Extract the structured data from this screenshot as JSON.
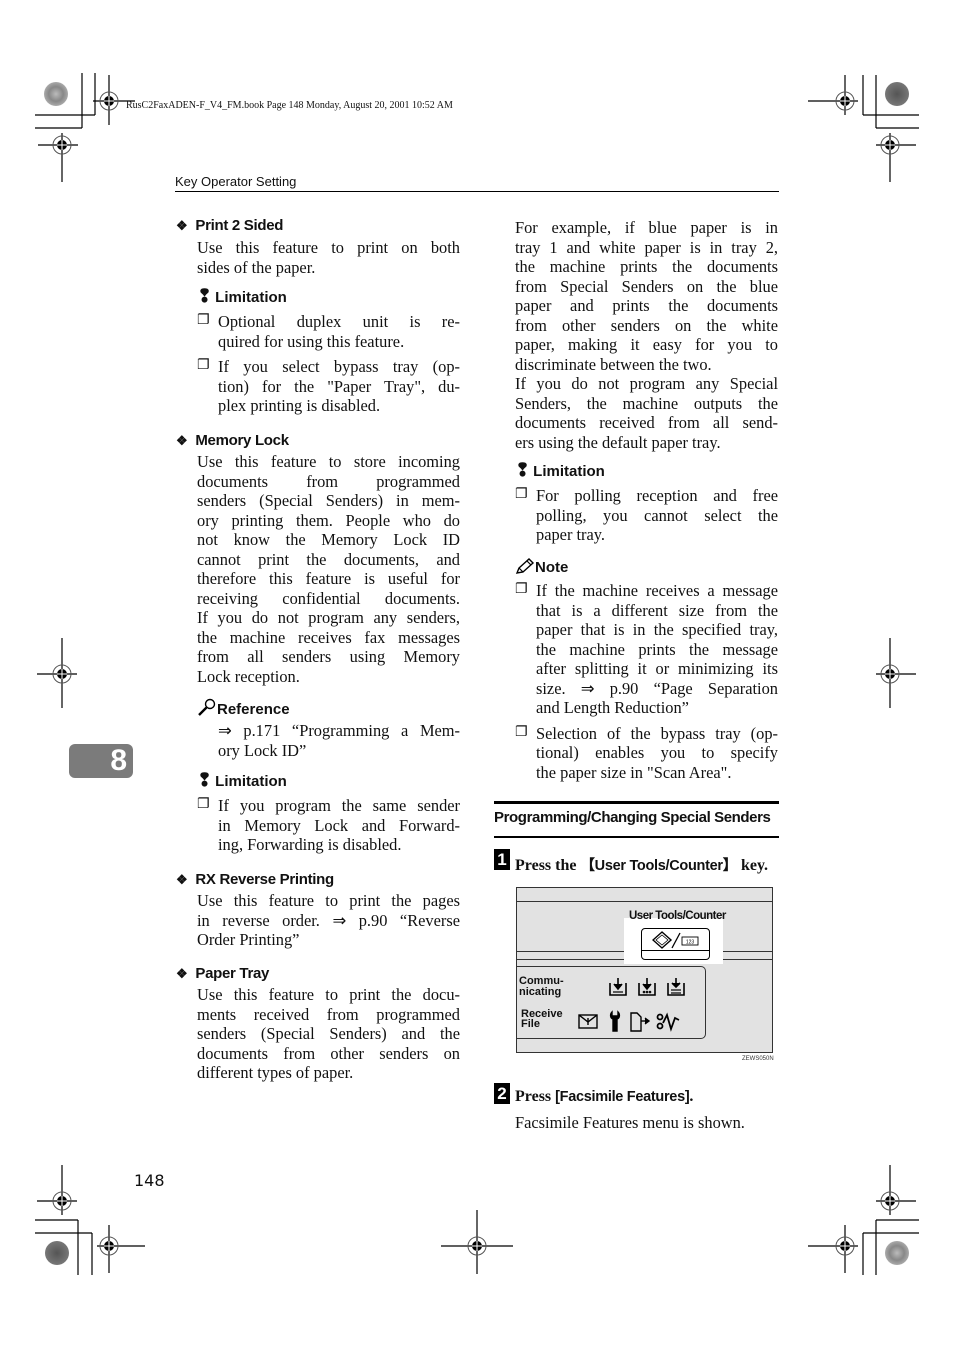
{
  "file_info": "RusC2FaxADEN-F_V4_FM.book  Page 148  Monday, August 20, 2001  10:52 AM",
  "running_head": "Key Operator Setting",
  "chapter_tab": "8",
  "page_number": "148",
  "left_column": {
    "print2sided": {
      "title": "Print 2 Sided",
      "body": [
        "Use this feature to print on both",
        "sides of the paper."
      ],
      "limitation_label": "Limitation",
      "items": [
        [
          "Optional duplex unit is re-",
          "quired for using this feature."
        ],
        [
          "If you select bypass tray (op-",
          "tion) for the \"Paper Tray\", du-",
          "plex printing is disabled."
        ]
      ]
    },
    "memory_lock": {
      "title": "Memory Lock",
      "body": [
        "Use this feature to store incoming",
        "documents from programmed",
        "senders (Special Senders) in mem-",
        "ory printing them. People who do",
        "not know the Memory Lock ID",
        "cannot print the documents, and",
        "therefore this feature is useful for",
        "receiving confidential documents.",
        "If you do not program any senders,",
        "the machine receives fax messages",
        "from all senders using Memory",
        "Lock reception."
      ],
      "reference_label": "Reference",
      "reference": [
        "⇒ p.171 “Programming a Mem-",
        "ory Lock ID”"
      ],
      "limitation_label": "Limitation",
      "items": [
        [
          "If you program the same sender",
          "in Memory Lock and Forward-",
          "ing, Forwarding is disabled."
        ]
      ]
    },
    "rx_reverse": {
      "title": "RX Reverse Printing",
      "body": [
        "Use this feature to print the pages",
        "in reverse order. ⇒ p.90 “Reverse",
        "Order Printing”"
      ]
    },
    "paper_tray": {
      "title": "Paper Tray",
      "body": [
        "Use this feature to print the docu-",
        "ments received from programmed",
        "senders (Special Senders) and the",
        "documents from other senders on",
        "different types of paper."
      ]
    }
  },
  "right_column": {
    "para1": [
      "For example, if blue paper is in",
      "tray 1 and white paper is in tray 2,",
      "the machine prints the documents",
      "from Special Senders on the blue",
      "paper and prints the documents",
      "from other senders on the white",
      "paper, making it easy for you to",
      "discriminate between the two."
    ],
    "para2": [
      "If you do not program any Special",
      "Senders, the machine outputs the",
      "documents received from all send-",
      "ers using the default paper tray."
    ],
    "limitation_label": "Limitation",
    "limitation_items": [
      [
        "For polling reception and free",
        "polling, you cannot select the",
        "paper tray."
      ]
    ],
    "note_label": "Note",
    "note_items": [
      [
        "If the machine receives a message",
        "that is a different size from the",
        "paper that is in the specified tray,",
        "the machine prints the message",
        "after splitting it or minimizing its",
        "size. ⇒ p.90 “Page Separation",
        "and Length Reduction”"
      ],
      [
        "Selection of the bypass tray (op-",
        "tional) enables you to specify",
        "the paper size in \"Scan Area\"."
      ]
    ],
    "section_title": "Programming/Changing Special Senders",
    "step1": {
      "num": "1",
      "pre": "Press the ",
      "key": "【User Tools/Counter】",
      "post": " key."
    },
    "panel": {
      "key_label": "User Tools/Counter",
      "communicating": [
        "Commu-",
        "nicating"
      ],
      "receive_file": [
        "Receive",
        "File"
      ],
      "counter_glyph": "123",
      "figure_id": "ZEWS050N"
    },
    "step2": {
      "num": "2",
      "pre": "Press ",
      "key": "[Facsimile Features]",
      "post": ".",
      "result": "Facsimile Features menu is shown."
    }
  }
}
